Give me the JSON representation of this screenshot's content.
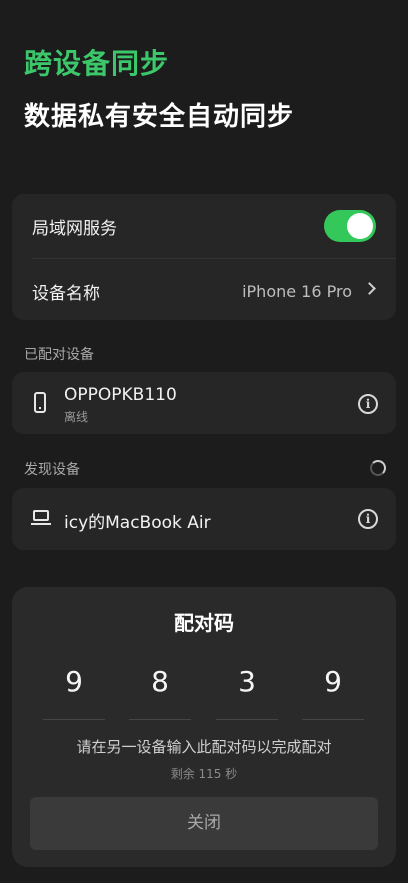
{
  "header": {
    "title": "跨设备同步",
    "subtitle": "数据私有安全自动同步"
  },
  "settings": {
    "lan_service_label": "局域网服务",
    "lan_service_enabled": true,
    "device_name_label": "设备名称",
    "device_name_value": "iPhone 16 Pro"
  },
  "paired": {
    "section_label": "已配对设备",
    "devices": [
      {
        "name": "OPPOPKB110",
        "status": "离线",
        "icon": "phone-icon"
      }
    ]
  },
  "discovered": {
    "section_label": "发现设备",
    "devices": [
      {
        "name": "icy的MacBook Air",
        "icon": "laptop-icon"
      }
    ]
  },
  "pairing_sheet": {
    "title": "配对码",
    "digits": [
      "9",
      "8",
      "3",
      "9"
    ],
    "hint": "请在另一设备输入此配对码以完成配对",
    "timer": "剩余 115 秒",
    "close_label": "关闭"
  },
  "colors": {
    "accent_green": "#3cc76b",
    "toggle_on": "#34c759",
    "background": "#1c1c1c",
    "card": "#262626"
  }
}
